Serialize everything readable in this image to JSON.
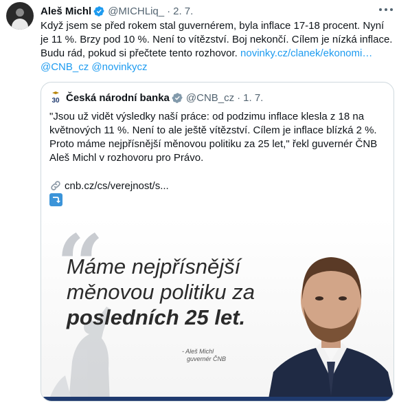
{
  "tweet": {
    "author_name": "Aleš Michl",
    "author_handle": "@MICHLiq_",
    "separator": "·",
    "date": "2. 7.",
    "text_lines": [
      "Když jsem se před rokem stal guvernérem, byla inflace 17-18 procent. Nyní",
      "je 11 %. Brzy pod 10 %. Není to vítězství. Boj nekončí. Cílem je nízká inflace.",
      "Budu rád, pokud si přečtete tento rozhovor."
    ],
    "link_text": "novinky.cz/clanek/ekonomi…",
    "mention_1": "@CNB_cz",
    "mention_2": "@novinkycz",
    "more_icon": "more-icon"
  },
  "quote": {
    "author_name": "Česká národní banka",
    "author_handle": "@CNB_cz",
    "separator": "·",
    "date": "1. 7.",
    "text_lines": [
      "\"Jsou už vidět výsledky naší práce: od podzimu inflace klesla z 18 na",
      "květnových 11 %. Není to ale ještě vítězství. Cílem je inflace blízká 2 %.",
      "Proto máme nejpřísnější měnovou politiku za 25 let,\" řekl guvernér ČNB",
      "Aleš Michl v rozhovoru pro Právo."
    ],
    "link_text": "cnb.cz/cs/verejnost/s...",
    "logo_text": "30",
    "image": {
      "headline_line_1": "Máme nejpřísnější",
      "headline_line_2": "měnovou politiku za",
      "headline_line_3": "posledních 25 let.",
      "signature_line_1": "- Aleš Michl",
      "signature_line_2": "guvernér ČNB"
    }
  },
  "colors": {
    "link": "#1d9bf0",
    "verified": "#1d9bf0",
    "secondary_text": "#536471",
    "border": "#cfd9de"
  }
}
